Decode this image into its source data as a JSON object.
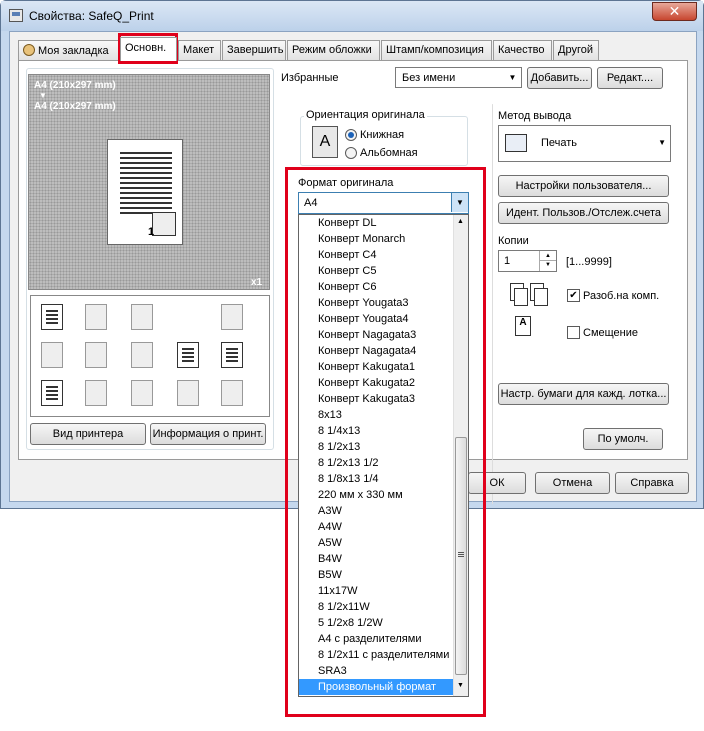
{
  "window": {
    "title": "Свойства: SafeQ_Print",
    "close": "✕"
  },
  "tabs": [
    {
      "label": "Моя закладка"
    },
    {
      "label": "Основн."
    },
    {
      "label": "Макет"
    },
    {
      "label": "Завершить"
    },
    {
      "label": "Режим обложки"
    },
    {
      "label": "Штамп/композиция"
    },
    {
      "label": "Качество"
    },
    {
      "label": "Другой"
    }
  ],
  "preview": {
    "line1": "A4 (210x297 mm)",
    "arrow": "▼",
    "line2": "A4 (210x297 mm)",
    "page_num": "1",
    "copies": "x1"
  },
  "favorites": {
    "label": "Избранные",
    "value": "Без имени",
    "add": "Добавить...",
    "edit": "Редакт...."
  },
  "orientation": {
    "title": "Ориентация оригинала",
    "portrait": "Книжная",
    "landscape": "Альбомная",
    "icon": "A"
  },
  "paper_size": {
    "title": "Формат оригинала",
    "value": "A4"
  },
  "output": {
    "title": "Метод вывода",
    "value": "Печать"
  },
  "buttons": {
    "user_settings": "Настройки пользователя...",
    "user_auth": "Идент. Пользов./Отслеж.счета",
    "tray_settings": "Настр. бумаги для кажд. лотка...",
    "defaults": "По умолч.",
    "printer_view": "Вид принтера",
    "printer_info": "Информация о принт.",
    "ok": "ОК",
    "cancel": "Отмена",
    "help": "Справка"
  },
  "copies": {
    "label": "Копии",
    "value": "1",
    "range": "[1...9999]"
  },
  "collate": {
    "label": "Разоб.на комп.",
    "checked": true
  },
  "offset": {
    "label": "Смещение",
    "checked": false
  },
  "dropdown_items": [
    "Конверт DL",
    "Конверт Monarch",
    "Конверт C4",
    "Конверт C5",
    "Конверт C6",
    "Конверт Yougata3",
    "Конверт Yougata4",
    "Конверт Nagagata3",
    "Конверт Nagagata4",
    "Конверт Kakugata1",
    "Конверт Kakugata2",
    "Конверт Kakugata3",
    "8x13",
    "8 1/4x13",
    "8 1/2x13",
    "8 1/2x13 1/2",
    "8 1/8x13 1/4",
    "220 мм x 330 мм",
    "A3W",
    "A4W",
    "A5W",
    "B4W",
    "B5W",
    "11x17W",
    "8 1/2x11W",
    "5 1/2x8 1/2W",
    "A4 с разделителями",
    "8 1/2x11 с разделителями",
    "SRA3",
    "Произвольный формат"
  ],
  "selected_item": "Произвольный формат",
  "colors": {
    "highlight": "#3399ff",
    "annotation": "#e0001b"
  }
}
